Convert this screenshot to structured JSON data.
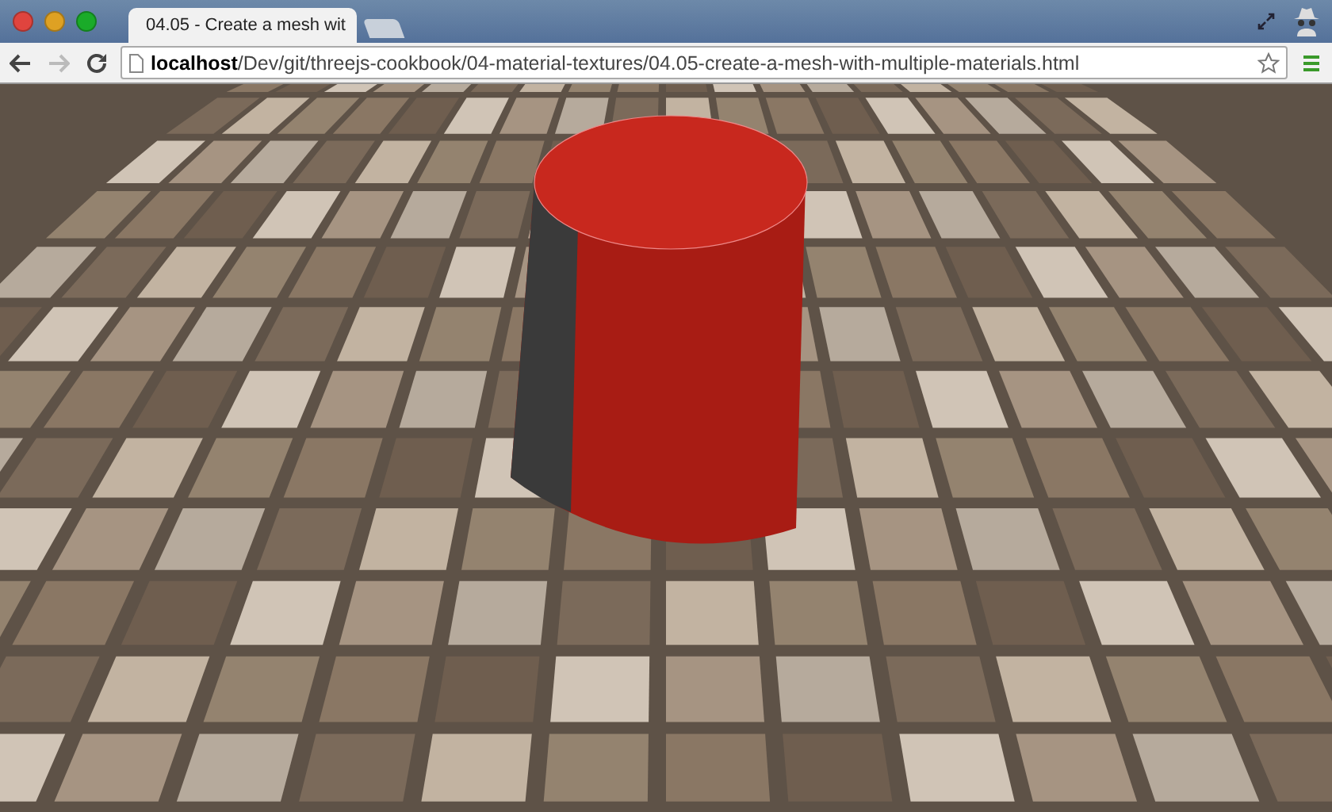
{
  "window": {
    "tab": {
      "title": "04.05 - Create a mesh wit",
      "selected": true
    }
  },
  "toolbar": {
    "url": "**localhost**/Dev/git/threejs-cookbook/04-material-textures/04.05-create-a-mesh-with-multiple-materials.html"
  }
}
